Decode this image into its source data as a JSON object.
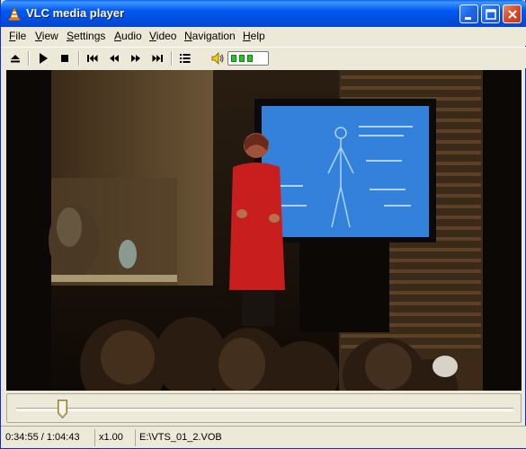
{
  "window": {
    "title": "VLC media player",
    "icon": "vlc-cone-icon"
  },
  "menu": {
    "items": [
      {
        "label_u": "F",
        "label_rest": "ile"
      },
      {
        "label_u": "V",
        "label_rest": "iew"
      },
      {
        "label_u": "S",
        "label_rest": "ettings"
      },
      {
        "label_u": "A",
        "label_rest": "udio"
      },
      {
        "label_u": "V",
        "label_rest": "ideo"
      },
      {
        "label_u": "N",
        "label_rest": "avigation"
      },
      {
        "label_u": "H",
        "label_rest": "elp"
      }
    ]
  },
  "toolbar": {
    "icons": [
      "eject-icon",
      "play-icon",
      "stop-icon",
      "skip-previous-icon",
      "rewind-icon",
      "fast-forward-icon",
      "skip-next-icon",
      "playlist-icon",
      "speaker-icon"
    ],
    "volume_level_segments": 3,
    "volume_color": "#23c423"
  },
  "seek": {
    "position_fraction": 0.093
  },
  "status": {
    "time": "0:34:55 / 1:04:43",
    "speed": "x1.00",
    "file": "E:\\VTS_01_2.VOB"
  },
  "colors": {
    "titlebar": "#0058ee",
    "window_bg": "#ece9d8",
    "close_button": "#d74a2a"
  }
}
